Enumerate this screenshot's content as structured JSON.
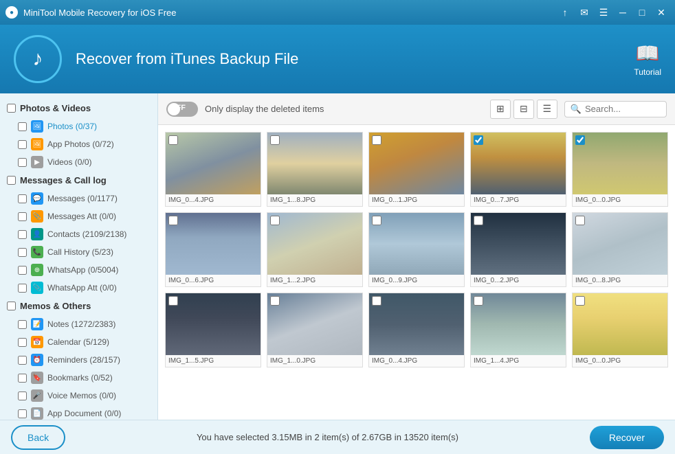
{
  "titleBar": {
    "title": "MiniTool Mobile Recovery for iOS Free",
    "controls": [
      "upload-icon",
      "mail-icon",
      "menu-icon",
      "minimize-icon",
      "maximize-icon",
      "close-icon"
    ]
  },
  "header": {
    "title": "Recover from iTunes Backup File",
    "tutorialLabel": "Tutorial"
  },
  "toolbar": {
    "toggleState": "OFF",
    "toggleLabel": "OFF",
    "displayText": "Only display the deleted items",
    "searchPlaceholder": "Search..."
  },
  "sidebar": {
    "groups": [
      {
        "label": "Photos & Videos",
        "checked": false,
        "items": [
          {
            "label": "Photos (0/37)",
            "icon": "image",
            "iconClass": "icon-blue",
            "checked": false,
            "active": true
          },
          {
            "label": "App Photos (0/72)",
            "icon": "image",
            "iconClass": "icon-orange",
            "checked": false
          },
          {
            "label": "Videos (0/0)",
            "icon": "video",
            "iconClass": "icon-gray",
            "checked": false
          }
        ]
      },
      {
        "label": "Messages & Call log",
        "checked": false,
        "items": [
          {
            "label": "Messages (0/1177)",
            "icon": "msg",
            "iconClass": "icon-blue",
            "checked": false
          },
          {
            "label": "Messages Att (0/0)",
            "icon": "attach",
            "iconClass": "icon-orange",
            "checked": false
          },
          {
            "label": "Contacts (2109/2138)",
            "icon": "contact",
            "iconClass": "icon-teal",
            "checked": false
          },
          {
            "label": "Call History (5/23)",
            "icon": "call",
            "iconClass": "icon-green",
            "checked": false
          },
          {
            "label": "WhatsApp (0/5004)",
            "icon": "wp",
            "iconClass": "icon-green",
            "checked": false
          },
          {
            "label": "WhatsApp Att (0/0)",
            "icon": "wp-att",
            "iconClass": "icon-cyan",
            "checked": false
          }
        ]
      },
      {
        "label": "Memos & Others",
        "checked": false,
        "items": [
          {
            "label": "Notes (1272/2383)",
            "icon": "note",
            "iconClass": "icon-blue",
            "checked": false
          },
          {
            "label": "Calendar (5/129)",
            "icon": "cal",
            "iconClass": "icon-orange",
            "checked": false
          },
          {
            "label": "Reminders (28/157)",
            "icon": "remind",
            "iconClass": "icon-blue",
            "checked": false
          },
          {
            "label": "Bookmarks (0/52)",
            "icon": "book",
            "iconClass": "icon-gray",
            "checked": false
          },
          {
            "label": "Voice Memos (0/0)",
            "icon": "voice",
            "iconClass": "icon-gray",
            "checked": false
          },
          {
            "label": "App Document (0/0)",
            "icon": "doc",
            "iconClass": "icon-gray",
            "checked": false
          }
        ]
      }
    ]
  },
  "photos": [
    {
      "label": "IMG_0...4.JPG",
      "thumbClass": "thumb-1",
      "checked": false
    },
    {
      "label": "IMG_1...8.JPG",
      "thumbClass": "thumb-2",
      "checked": false
    },
    {
      "label": "IMG_0...1.JPG",
      "thumbClass": "thumb-3",
      "checked": false
    },
    {
      "label": "IMG_0...7.JPG",
      "thumbClass": "thumb-4",
      "checked": true
    },
    {
      "label": "IMG_0...0.JPG",
      "thumbClass": "thumb-5",
      "checked": true
    },
    {
      "label": "IMG_0...6.JPG",
      "thumbClass": "thumb-6",
      "checked": false
    },
    {
      "label": "IMG_1...2.JPG",
      "thumbClass": "thumb-7",
      "checked": false
    },
    {
      "label": "IMG_0...9.JPG",
      "thumbClass": "thumb-8",
      "checked": false
    },
    {
      "label": "IMG_0...2.JPG",
      "thumbClass": "thumb-9",
      "checked": false
    },
    {
      "label": "IMG_0...8.JPG",
      "thumbClass": "thumb-10",
      "checked": false
    },
    {
      "label": "IMG_1...5.JPG",
      "thumbClass": "thumb-11",
      "checked": false
    },
    {
      "label": "IMG_1...0.JPG",
      "thumbClass": "thumb-12",
      "checked": false
    },
    {
      "label": "IMG_0...4.JPG",
      "thumbClass": "thumb-13",
      "checked": false
    },
    {
      "label": "IMG_1...4.JPG",
      "thumbClass": "thumb-14",
      "checked": false
    },
    {
      "label": "IMG_0...0.JPG",
      "thumbClass": "thumb-15",
      "checked": false
    }
  ],
  "statusBar": {
    "backLabel": "Back",
    "statusText": "You have selected 3.15MB in 2 item(s) of 2.67GB in 13520 item(s)",
    "recoverLabel": "Recover"
  }
}
